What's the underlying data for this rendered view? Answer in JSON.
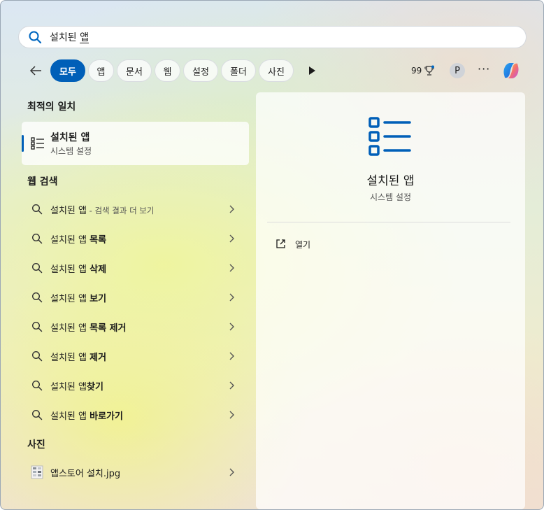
{
  "search": {
    "query_prefix": "설치된 ",
    "query_underlined": "앱"
  },
  "filters": {
    "tabs": [
      {
        "label": "모두",
        "active": true
      },
      {
        "label": "앱"
      },
      {
        "label": "문서"
      },
      {
        "label": "웹"
      },
      {
        "label": "설정"
      },
      {
        "label": "폴더"
      },
      {
        "label": "사진"
      }
    ],
    "points": "99",
    "avatar_letter": "P",
    "more": "···"
  },
  "best_match": {
    "section_title": "최적의 일치",
    "title": "설치된 앱",
    "subtitle": "시스템 설정",
    "icon": "list-icon"
  },
  "web_search": {
    "section_title": "웹 검색",
    "items": [
      {
        "base": "설치된 앱",
        "bold": "",
        "hint": " - 검색 결과 더 보기"
      },
      {
        "base": "설치된 앱 ",
        "bold": "목록",
        "hint": ""
      },
      {
        "base": "설치된 앱 ",
        "bold": "삭제",
        "hint": ""
      },
      {
        "base": "설치된 앱 ",
        "bold": "보기",
        "hint": ""
      },
      {
        "base": "설치된 앱 ",
        "bold": "목록 제거",
        "hint": ""
      },
      {
        "base": "설치된 앱 ",
        "bold": "제거",
        "hint": ""
      },
      {
        "base": "설치된 앱",
        "bold": "찾기",
        "hint": ""
      },
      {
        "base": "설치된 앱 ",
        "bold": "바로가기",
        "hint": ""
      }
    ]
  },
  "photos": {
    "section_title": "사진",
    "items": [
      {
        "name": "앱스토어 설치.jpg"
      }
    ]
  },
  "detail": {
    "title": "설치된 앱",
    "subtitle": "시스템 설정",
    "actions": [
      {
        "label": "열기",
        "icon": "open-external-icon"
      }
    ]
  },
  "colors": {
    "accent": "#005fb8"
  }
}
